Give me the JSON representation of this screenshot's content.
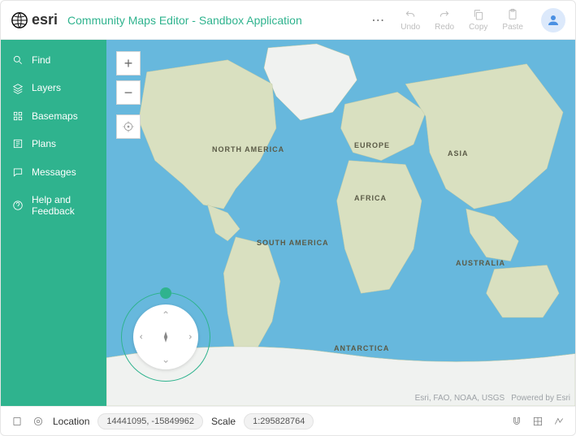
{
  "header": {
    "brand": "esri",
    "app_title": "Community Maps Editor - Sandbox Application",
    "actions": {
      "undo": "Undo",
      "redo": "Redo",
      "copy": "Copy",
      "paste": "Paste"
    }
  },
  "sidebar": {
    "items": [
      {
        "label": "Find"
      },
      {
        "label": "Layers"
      },
      {
        "label": "Basemaps"
      },
      {
        "label": "Plans"
      },
      {
        "label": "Messages"
      },
      {
        "label": "Help and Feedback"
      }
    ]
  },
  "map": {
    "continents": {
      "north_america": "NORTH AMERICA",
      "south_america": "SOUTH AMERICA",
      "europe": "EUROPE",
      "africa": "AFRICA",
      "asia": "ASIA",
      "australia": "AUSTRALIA",
      "antarctica": "ANTARCTICA"
    },
    "attribution": "Esri, FAO, NOAA, USGS",
    "powered_by": "Powered by Esri"
  },
  "statusbar": {
    "location_label": "Location",
    "location_value": "14441095, -15849962",
    "scale_label": "Scale",
    "scale_value": "1:295828764"
  }
}
